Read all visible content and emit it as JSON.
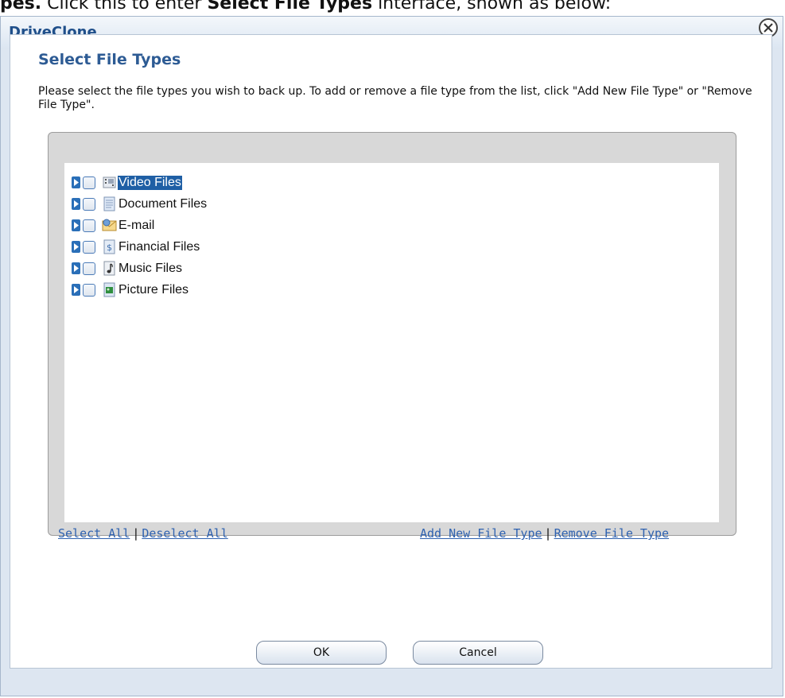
{
  "doc": {
    "prefix": "pes.",
    "mid1": " Click this to enter ",
    "bold": "Select File Types",
    "mid2": " interface, shown as below:"
  },
  "window": {
    "title": "DriveClone"
  },
  "dialog": {
    "heading": "Select File Types",
    "description": "Please select the file types you wish to back up. To add or remove a file type from the list, click \"Add New File Type\" or \"Remove File Type\"."
  },
  "file_types": [
    {
      "label": "Video Files",
      "icon": "video-icon",
      "checked": false,
      "selected": true
    },
    {
      "label": "Document Files",
      "icon": "document-icon",
      "checked": false,
      "selected": false
    },
    {
      "label": "E-mail",
      "icon": "email-icon",
      "checked": false,
      "selected": false
    },
    {
      "label": "Financial Files",
      "icon": "financial-icon",
      "checked": false,
      "selected": false
    },
    {
      "label": "Music Files",
      "icon": "music-icon",
      "checked": false,
      "selected": false
    },
    {
      "label": "Picture Files",
      "icon": "picture-icon",
      "checked": false,
      "selected": false
    }
  ],
  "links": {
    "select_all": "Select All",
    "deselect_all": "Deselect All",
    "add_new": "Add New File Type",
    "remove": "Remove File Type",
    "separator": "|"
  },
  "buttons": {
    "ok": "OK",
    "cancel": "Cancel"
  },
  "colors": {
    "accent": "#1f4f8a",
    "link": "#2f62b0",
    "selection": "#1f5fa5"
  }
}
